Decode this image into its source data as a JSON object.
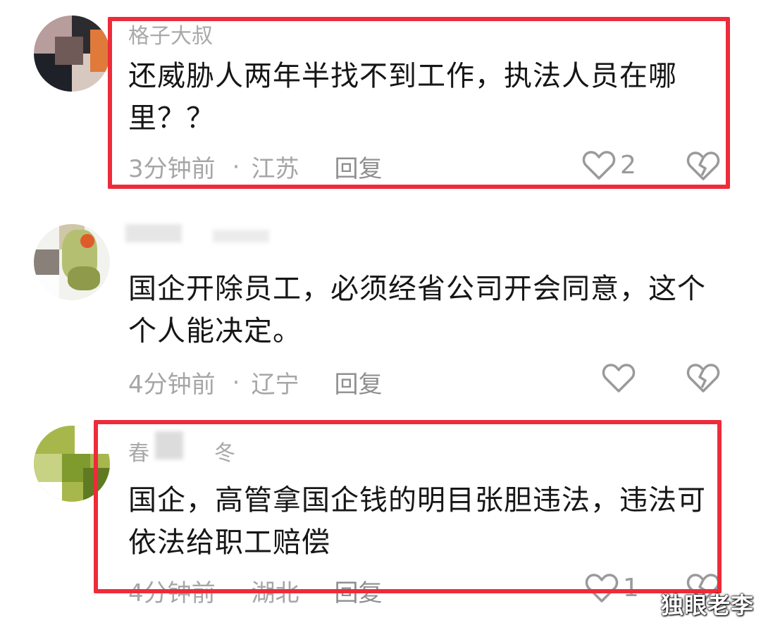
{
  "comments": [
    {
      "username": "格子大叔",
      "text": "还威胁人两年半找不到工作，执法人员在哪里？？",
      "time": "3分钟前",
      "separator": "·",
      "location": "江苏",
      "reply": "回复",
      "likes": "2",
      "highlighted": true
    },
    {
      "username": "",
      "text": "国企开除员工，必须经省公司开会同意，这个个人能决定。",
      "time": "4分钟前",
      "separator": "·",
      "location": "辽宁",
      "reply": "回复",
      "likes": "",
      "highlighted": false
    },
    {
      "username_start": "春",
      "username_end": "冬",
      "text": "国企，高管拿国企钱的明目张胆违法，违法可依法给职工赔偿",
      "time": "4分钟前",
      "separator": "·",
      "location": "湖北",
      "reply": "回复",
      "likes": "1",
      "highlighted": true
    }
  ],
  "watermark": "独眼老李",
  "colors": {
    "highlight_border": "#ee2b3a",
    "secondary_text": "#a6a6a6",
    "primary_text": "#161616"
  },
  "icons": {
    "like": "heart-outline-icon",
    "dislike": "broken-heart-icon"
  }
}
